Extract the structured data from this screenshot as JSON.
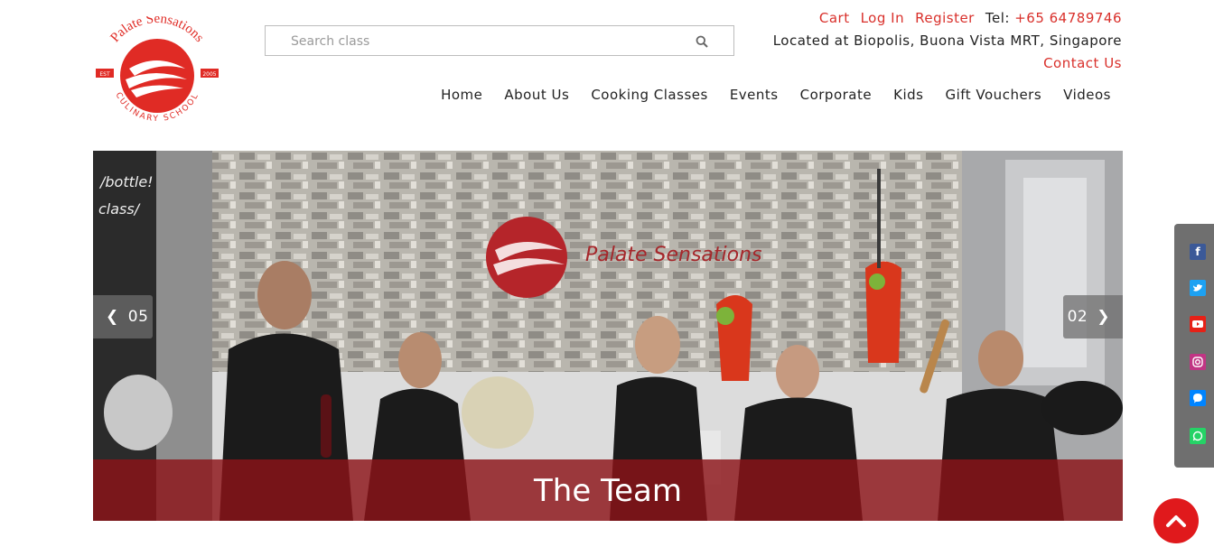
{
  "brand": {
    "logo_top_text": "Palate Sensations",
    "logo_bottom_text": "CULINARY SCHOOL",
    "logo_est": "EST",
    "logo_year": "2005",
    "accent_color": "#d9302b"
  },
  "search": {
    "placeholder": "Search class",
    "icon": "search-icon"
  },
  "top_links": {
    "cart": "Cart",
    "login": "Log In",
    "register": "Register",
    "tel_label": "Tel:",
    "tel_number": "+65 64789746"
  },
  "location": "Located at Biopolis, Buona Vista MRT, Singapore",
  "contact": "Contact Us",
  "nav": {
    "items": [
      {
        "label": "Home"
      },
      {
        "label": "About Us"
      },
      {
        "label": "Cooking Classes"
      },
      {
        "label": "Events"
      },
      {
        "label": "Corporate"
      },
      {
        "label": "Kids"
      },
      {
        "label": "Gift Vouchers"
      },
      {
        "label": "Videos"
      }
    ]
  },
  "hero": {
    "caption": "The Team",
    "prev_number": "05",
    "next_number": "02",
    "wall_sign": "Palate Sensations",
    "chalk_1": "/bottle!",
    "chalk_2": "class/"
  },
  "social": {
    "items": [
      {
        "icon": "facebook-icon",
        "color": "#3b5998"
      },
      {
        "icon": "twitter-icon",
        "color": "#1da1f2"
      },
      {
        "icon": "youtube-icon",
        "color": "#e62117"
      },
      {
        "icon": "instagram-icon",
        "color": "#c13584"
      },
      {
        "icon": "messenger-icon",
        "color": "#0084ff"
      },
      {
        "icon": "whatsapp-icon",
        "color": "#25d366"
      }
    ]
  },
  "back_to_top": {
    "icon": "chevron-up-icon",
    "color": "#e0191c"
  }
}
